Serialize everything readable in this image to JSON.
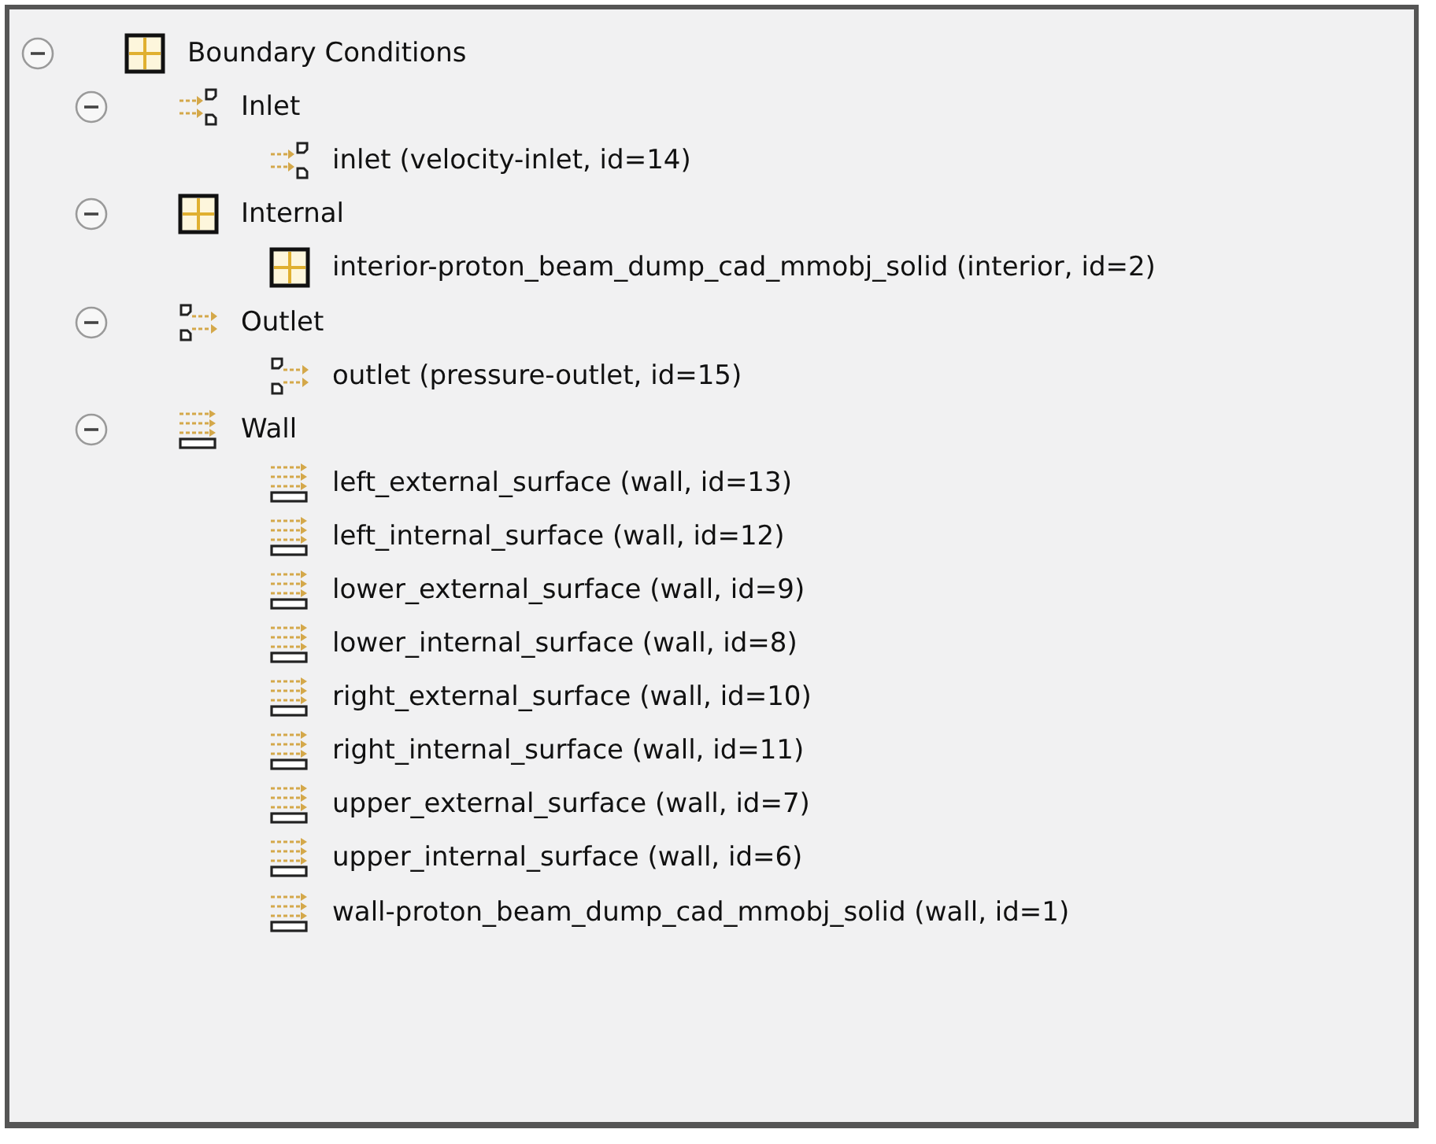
{
  "tree": [
    {
      "label": "Boundary Conditions",
      "kind": "grid",
      "expanded": true,
      "children": [
        {
          "label": "Inlet",
          "kind": "inlet",
          "expanded": true,
          "children": [
            {
              "label": "inlet (velocity-inlet, id=14)",
              "kind": "inlet"
            }
          ]
        },
        {
          "label": "Internal",
          "kind": "grid",
          "expanded": true,
          "children": [
            {
              "label": "interior-proton_beam_dump_cad_mmobj_solid (interior, id=2)",
              "kind": "grid"
            }
          ]
        },
        {
          "label": "Outlet",
          "kind": "outlet",
          "expanded": true,
          "children": [
            {
              "label": "outlet (pressure-outlet, id=15)",
              "kind": "outlet"
            }
          ]
        },
        {
          "label": "Wall",
          "kind": "wall",
          "expanded": true,
          "children": [
            {
              "label": "left_external_surface (wall, id=13)",
              "kind": "wall"
            },
            {
              "label": "left_internal_surface (wall, id=12)",
              "kind": "wall"
            },
            {
              "label": "lower_external_surface (wall, id=9)",
              "kind": "wall"
            },
            {
              "label": "lower_internal_surface (wall, id=8)",
              "kind": "wall"
            },
            {
              "label": "right_external_surface (wall, id=10)",
              "kind": "wall"
            },
            {
              "label": "right_internal_surface (wall, id=11)",
              "kind": "wall"
            },
            {
              "label": "upper_external_surface (wall, id=7)",
              "kind": "wall"
            },
            {
              "label": "upper_internal_surface (wall, id=6)",
              "kind": "wall"
            },
            {
              "label": "wall-proton_beam_dump_cad_mmobj_solid (wall, id=1)",
              "kind": "wall"
            }
          ]
        }
      ]
    }
  ]
}
